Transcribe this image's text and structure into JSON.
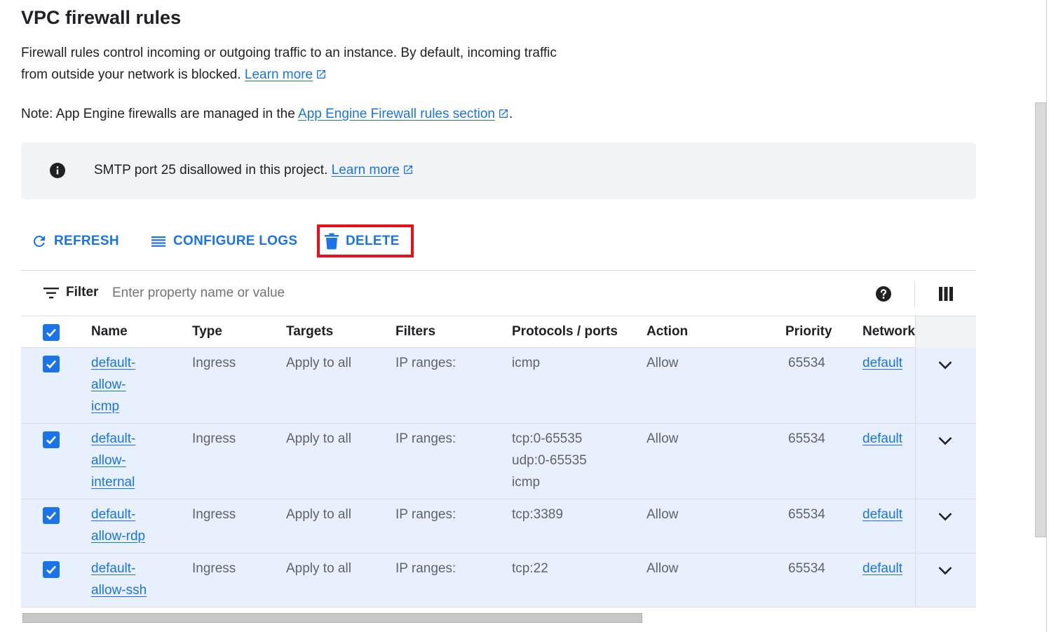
{
  "page": {
    "title": "VPC firewall rules",
    "description": "Firewall rules control incoming or outgoing traffic to an instance. By default, incoming traffic from outside your network is blocked.",
    "learn_more": "Learn more",
    "note_prefix": "Note: App Engine firewalls are managed in the",
    "note_link": "App Engine Firewall rules section",
    "note_suffix": "."
  },
  "banner": {
    "message": "SMTP port 25 disallowed in this project.",
    "learn_more": "Learn more"
  },
  "toolbar": {
    "refresh_label": "REFRESH",
    "configure_logs_label": "CONFIGURE LOGS",
    "delete_label": "DELETE",
    "highlight_color": "#e8101b"
  },
  "filter": {
    "label": "Filter",
    "placeholder": "Enter property name or value"
  },
  "table": {
    "columns": [
      "Name",
      "Type",
      "Targets",
      "Filters",
      "Protocols / ports",
      "Action",
      "Priority",
      "Network"
    ],
    "rows": [
      {
        "name": [
          "default-",
          "allow-",
          "icmp"
        ],
        "type": "Ingress",
        "targets": "Apply to all",
        "filters": "IP ranges:",
        "protocols": [
          "icmp"
        ],
        "action": "Allow",
        "priority": "65534",
        "network": "default",
        "checked": true
      },
      {
        "name": [
          "default-",
          "allow-",
          "internal"
        ],
        "type": "Ingress",
        "targets": "Apply to all",
        "filters": "IP ranges:",
        "protocols": [
          "tcp:0-65535",
          "udp:0-65535",
          "icmp"
        ],
        "action": "Allow",
        "priority": "65534",
        "network": "default",
        "checked": true
      },
      {
        "name": [
          "default-",
          "allow-rdp"
        ],
        "type": "Ingress",
        "targets": "Apply to all",
        "filters": "IP ranges:",
        "protocols": [
          "tcp:3389"
        ],
        "action": "Allow",
        "priority": "65534",
        "network": "default",
        "checked": true
      },
      {
        "name": [
          "default-",
          "allow-ssh"
        ],
        "type": "Ingress",
        "targets": "Apply to all",
        "filters": "IP ranges:",
        "protocols": [
          "tcp:22"
        ],
        "action": "Allow",
        "priority": "65534",
        "network": "default",
        "checked": true
      }
    ]
  },
  "colors": {
    "accent": "#1a73e8",
    "row_selected": "#e8f0fe",
    "banner_bg": "#f1f3f4"
  }
}
